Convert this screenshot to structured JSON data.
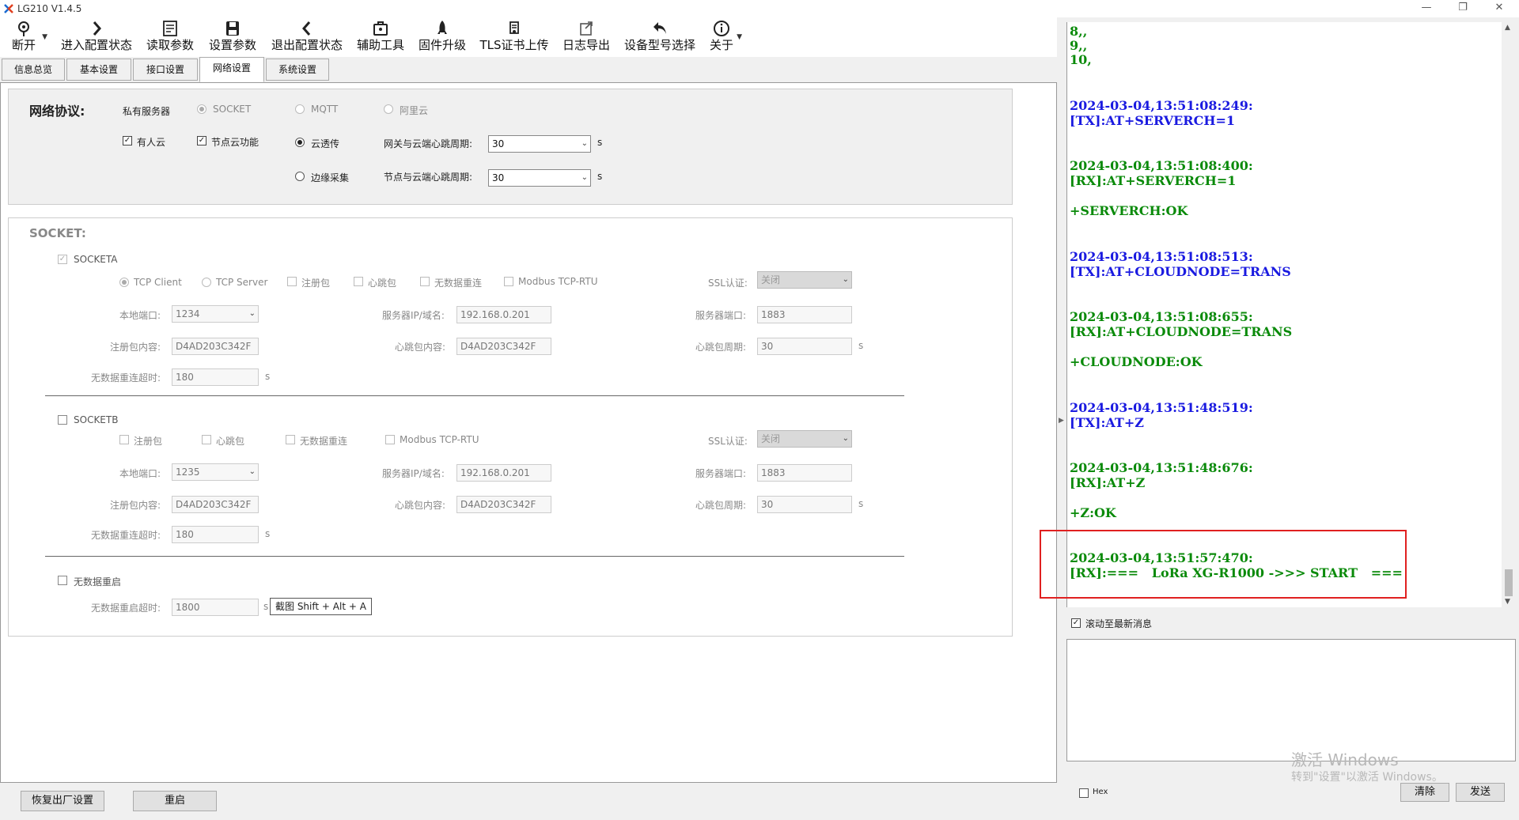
{
  "window": {
    "title": "LG210 V1.4.5",
    "icon": "app-logo-icon",
    "controls": [
      "minimize-icon",
      "restore-icon",
      "close-icon"
    ]
  },
  "toolbar": [
    {
      "label": "断开",
      "icon": "location-pin-icon"
    },
    {
      "label": "进入配置状态",
      "icon": "chevron-right-icon"
    },
    {
      "label": "读取参数",
      "icon": "read-params-icon"
    },
    {
      "label": "设置参数",
      "icon": "save-icon"
    },
    {
      "label": "退出配置状态",
      "icon": "chevron-left-icon"
    },
    {
      "label": "辅助工具",
      "icon": "toolbox-icon"
    },
    {
      "label": "固件升级",
      "icon": "rocket-icon"
    },
    {
      "label": "TLS证书上传",
      "icon": "certificate-icon"
    },
    {
      "label": "日志导出",
      "icon": "export-icon"
    },
    {
      "label": "设备型号选择",
      "icon": "undo-icon"
    },
    {
      "label": "关于",
      "icon": "info-icon"
    }
  ],
  "tabs": [
    {
      "label": "信息总览",
      "active": false
    },
    {
      "label": "基本设置",
      "active": false
    },
    {
      "label": "接口设置",
      "active": false
    },
    {
      "label": "网络设置",
      "active": true
    },
    {
      "label": "系统设置",
      "active": false
    }
  ],
  "network": {
    "heading": "网络协议:",
    "private_server": "私有服务器",
    "socket": "SOCKET",
    "mqtt": "MQTT",
    "aliyun": "阿里云",
    "usr_cloud": "有人云",
    "node_cloud": "节点云功能",
    "cloud_transparent": "云透传",
    "edge_collect": "边缘采集",
    "gw_heartbeat_label": "网关与云端心跳周期:",
    "gw_heartbeat_value": "30",
    "node_heartbeat_label": "节点与云端心跳周期:",
    "node_heartbeat_value": "30",
    "unit_s": "s"
  },
  "socket_section": {
    "heading": "SOCKET:",
    "socketa": {
      "label": "SOCKETA",
      "tcp_client": "TCP Client",
      "tcp_server": "TCP Server",
      "reg_packet": "注册包",
      "heartbeat": "心跳包",
      "no_data_reconnect": "无数据重连",
      "modbus": "Modbus TCP-RTU",
      "ssl_label": "SSL认证:",
      "ssl_value": "关闭",
      "local_port_label": "本地端口:",
      "local_port": "1234",
      "server_ip_label": "服务器IP/域名:",
      "server_ip": "192.168.0.201",
      "server_port_label": "服务器端口:",
      "server_port": "1883",
      "reg_content_label": "注册包内容:",
      "reg_content": "D4AD203C342F",
      "hb_content_label": "心跳包内容:",
      "hb_content": "D4AD203C342F",
      "hb_period_label": "心跳包周期:",
      "hb_period": "30",
      "reconnect_timeout_label": "无数据重连超时:",
      "reconnect_timeout": "180",
      "unit_s": "s"
    },
    "socketb": {
      "label": "SOCKETB",
      "reg_packet": "注册包",
      "heartbeat": "心跳包",
      "no_data_reconnect": "无数据重连",
      "modbus": "Modbus TCP-RTU",
      "ssl_label": "SSL认证:",
      "ssl_value": "关闭",
      "local_port_label": "本地端口:",
      "local_port": "1235",
      "server_ip_label": "服务器IP/域名:",
      "server_ip": "192.168.0.201",
      "server_port_label": "服务器端口:",
      "server_port": "1883",
      "reg_content_label": "注册包内容:",
      "reg_content": "D4AD203C342F",
      "hb_content_label": "心跳包内容:",
      "hb_content": "D4AD203C342F",
      "hb_period_label": "心跳包周期:",
      "hb_period": "30",
      "reconnect_timeout_label": "无数据重连超时:",
      "reconnect_timeout": "180",
      "unit_s": "s"
    },
    "no_data_restart": "无数据重启",
    "restart_timeout_label": "无数据重启超时:",
    "restart_timeout": "1800",
    "restart_unit": "s",
    "tooltip": "截图 Shift + Alt + A"
  },
  "bottom_buttons": {
    "factory_reset": "恢复出厂设置",
    "restart": "重启"
  },
  "log": {
    "colors": {
      "rx": "#0a8a0a",
      "tx": "#1a1ae0"
    },
    "lines": [
      {
        "text": "8,,",
        "kind": "rx"
      },
      {
        "text": "9,,",
        "kind": "rx"
      },
      {
        "text": "10,",
        "kind": "rx"
      },
      {
        "text": "2024-03-04,13:51:08:249:",
        "kind": "tx"
      },
      {
        "text": "[TX]:AT+SERVERCH=1",
        "kind": "tx"
      },
      {
        "text": "2024-03-04,13:51:08:400:",
        "kind": "rx"
      },
      {
        "text": "[RX]:AT+SERVERCH=1",
        "kind": "rx"
      },
      {
        "text": "+SERVERCH:OK",
        "kind": "rx"
      },
      {
        "text": "2024-03-04,13:51:08:513:",
        "kind": "tx"
      },
      {
        "text": "[TX]:AT+CLOUDNODE=TRANS",
        "kind": "tx"
      },
      {
        "text": "2024-03-04,13:51:08:655:",
        "kind": "rx"
      },
      {
        "text": "[RX]:AT+CLOUDNODE=TRANS",
        "kind": "rx"
      },
      {
        "text": "+CLOUDNODE:OK",
        "kind": "rx"
      },
      {
        "text": "2024-03-04,13:51:48:519:",
        "kind": "tx"
      },
      {
        "text": "[TX]:AT+Z",
        "kind": "tx"
      },
      {
        "text": "2024-03-04,13:51:48:676:",
        "kind": "rx"
      },
      {
        "text": "[RX]:AT+Z",
        "kind": "rx"
      },
      {
        "text": "+Z:OK",
        "kind": "rx"
      },
      {
        "text": "2024-03-04,13:51:57:470:",
        "kind": "rx"
      },
      {
        "text": "[RX]:===   LoRa XG-R1000 ->>> START   ===",
        "kind": "rx"
      }
    ]
  },
  "auto_scroll": "滚动至最新消息",
  "hex_label": "Hex",
  "clear_label": "清除",
  "send_label": "发送",
  "watermark": {
    "line1": "激活 Windows",
    "line2": "转到\"设置\"以激活 Windows。"
  }
}
